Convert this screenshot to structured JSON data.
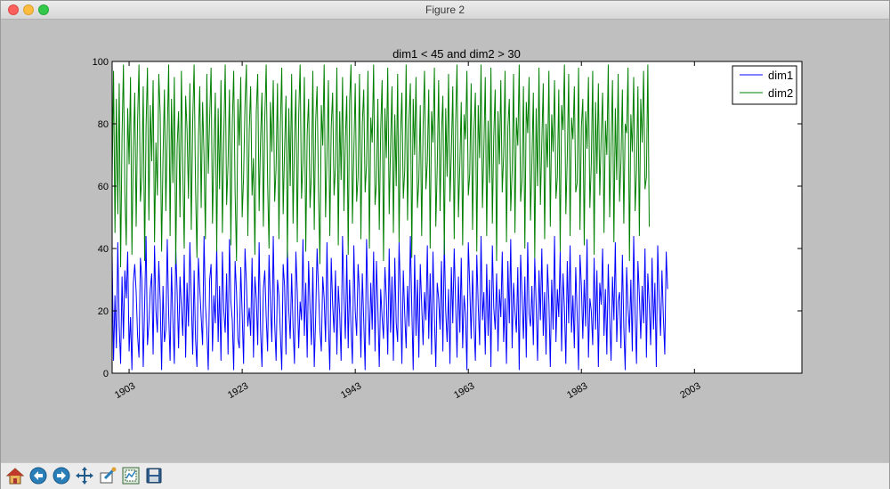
{
  "window": {
    "title": "Figure 2"
  },
  "toolbar": {
    "buttons": [
      {
        "name": "home-button",
        "icon": "home-icon"
      },
      {
        "name": "back-button",
        "icon": "back-arrow-icon"
      },
      {
        "name": "forward-button",
        "icon": "forward-arrow-icon"
      },
      {
        "name": "pan-button",
        "icon": "pan-arrows-icon"
      },
      {
        "name": "zoom-button",
        "icon": "zoom-rect-icon"
      },
      {
        "name": "subplots-button",
        "icon": "subplots-config-icon"
      },
      {
        "name": "save-button",
        "icon": "floppy-disk-icon"
      }
    ]
  },
  "chart_data": {
    "type": "line",
    "title": "dim1 < 45 and dim2 > 30",
    "xlabel": "",
    "ylabel": "",
    "xlim": [
      1900,
      2022
    ],
    "ylim": [
      0,
      100
    ],
    "xticks": [
      "1903",
      "1923",
      "1943",
      "1963",
      "1983",
      "2003"
    ],
    "yticks": [
      0,
      20,
      40,
      60,
      80,
      100
    ],
    "legend": {
      "loc": "upper right",
      "entries": [
        "dim1",
        "dim2"
      ]
    },
    "grid": false,
    "colors": {
      "dim1": "#0000ff",
      "dim2": "#007f00"
    },
    "series": [
      {
        "name": "dim1",
        "x_start": 1900,
        "x_step": 0.25,
        "values": [
          38,
          4,
          25,
          8,
          42,
          15,
          3,
          31,
          11,
          33,
          24,
          39,
          7,
          18,
          1,
          29,
          35,
          26,
          12,
          5,
          37,
          30,
          2,
          22,
          44,
          9,
          16,
          27,
          32,
          6,
          41,
          20,
          13,
          36,
          23,
          1,
          28,
          10,
          14,
          43,
          19,
          4,
          34,
          17,
          3,
          40,
          26,
          8,
          31,
          21,
          12,
          38,
          5,
          29,
          15,
          42,
          24,
          6,
          33,
          11,
          2,
          37,
          27,
          18,
          9,
          44,
          22,
          14,
          1,
          30,
          35,
          7,
          25,
          16,
          41,
          10,
          28,
          4,
          39,
          20,
          13,
          32,
          6,
          43,
          23,
          17,
          1,
          36,
          26,
          11,
          8,
          34,
          19,
          3,
          40,
          29,
          15,
          21,
          12,
          37,
          5,
          31,
          24,
          9,
          42,
          14,
          2,
          27,
          33,
          18,
          7,
          38,
          22,
          10,
          44,
          16,
          4,
          30,
          25,
          13,
          1,
          35,
          28,
          6,
          41,
          20,
          11,
          32,
          15,
          3,
          39,
          26,
          8,
          23,
          17,
          43,
          12,
          29,
          5,
          36,
          21,
          9,
          34,
          2,
          18,
          40,
          27,
          14,
          7,
          31,
          24,
          10,
          42,
          16,
          1,
          37,
          22,
          13,
          33,
          6,
          28,
          19,
          4,
          44,
          25,
          11,
          38,
          8,
          30,
          15,
          3,
          41,
          20,
          12,
          35,
          26,
          5,
          32,
          17,
          1,
          43,
          23,
          9,
          29,
          14,
          39,
          7,
          36,
          21,
          2,
          27,
          18,
          11,
          34,
          24,
          6,
          40,
          13,
          31,
          4,
          37,
          16,
          10,
          42,
          25,
          3,
          33,
          19,
          8,
          28,
          15,
          44,
          21,
          1,
          38,
          12,
          30,
          5,
          35,
          22,
          9,
          26,
          17,
          41,
          11,
          32,
          6,
          39,
          18,
          2,
          29,
          24,
          14,
          36,
          7,
          43,
          20,
          10,
          27,
          3,
          34,
          16,
          40,
          23,
          5,
          31,
          13,
          37,
          8,
          25,
          19,
          1,
          42,
          28,
          11,
          33,
          15,
          4,
          38,
          22,
          9,
          44,
          17,
          26,
          6,
          35,
          12,
          30,
          2,
          41,
          21,
          14,
          32,
          7,
          27,
          18,
          39,
          10,
          24,
          3,
          36,
          16,
          43,
          8,
          29,
          20,
          13,
          34,
          1,
          38,
          25,
          11,
          31,
          5,
          42,
          19,
          15,
          28,
          9,
          37,
          22,
          4,
          33,
          17,
          40,
          12,
          26,
          6,
          35,
          23,
          2,
          30,
          14,
          44,
          10,
          27,
          18,
          39,
          7,
          32,
          21,
          3,
          36,
          16,
          41,
          13,
          25,
          8,
          34,
          19,
          1,
          38,
          28,
          11,
          30,
          15,
          43,
          5,
          24,
          20,
          9,
          37,
          14,
          33,
          2,
          29,
          22,
          40,
          12,
          27,
          6,
          35,
          18,
          4,
          31,
          17,
          42,
          10,
          23,
          26,
          8,
          38,
          15,
          1,
          34,
          21,
          13,
          30,
          7,
          44,
          19,
          3,
          36,
          25,
          11,
          28,
          16,
          40,
          5,
          32,
          22,
          9,
          37,
          14,
          29,
          2,
          41,
          24,
          12,
          33,
          18,
          6,
          39,
          27
        ]
      },
      {
        "name": "dim2",
        "x_start": 1900,
        "x_step": 0.25,
        "values": [
          62,
          97,
          45,
          88,
          51,
          93,
          34,
          76,
          99,
          58,
          41,
          85,
          67,
          95,
          38,
          72,
          90,
          47,
          81,
          99,
          55,
          63,
          92,
          36,
          79,
          98,
          49,
          86,
          68,
          94,
          42,
          74,
          57,
          96,
          83,
          39,
          69,
          91,
          52,
          77,
          99,
          44,
          88,
          61,
          95,
          35,
          73,
          84,
          50,
          97,
          65,
          40,
          89,
          78,
          56,
          93,
          46,
          81,
          99,
          60,
          37,
          75,
          92,
          53,
          87,
          70,
          43,
          96,
          64,
          82,
          98,
          48,
          71,
          90,
          39,
          85,
          59,
          94,
          45,
          76,
          99,
          54,
          67,
          91,
          41,
          80,
          97,
          58,
          36,
          88,
          73,
          95,
          50,
          63,
          86,
          99,
          44,
          78,
          92,
          57,
          69,
          38,
          84,
          96,
          52,
          75,
          90,
          47,
          82,
          99,
          61,
          40,
          87,
          71,
          94,
          55,
          66,
          93,
          43,
          79,
          98,
          51,
          72,
          89,
          37,
          85,
          60,
          96,
          48,
          74,
          91,
          42,
          83,
          99,
          56,
          68,
          95,
          39,
          77,
          88,
          53,
          64,
          97,
          46,
          81,
          92,
          59,
          35,
          86,
          73,
          99,
          50,
          70,
          94,
          44,
          79,
          90,
          57,
          66,
          98,
          41,
          84,
          62,
          95,
          52,
          75,
          89,
          38,
          87,
          99,
          48,
          71,
          93,
          55,
          63,
          96,
          43,
          80,
          91,
          58,
          67,
          97,
          40,
          82,
          74,
          99,
          54,
          61,
          88,
          46,
          78,
          94,
          36,
          85,
          69,
          98,
          51,
          73,
          92,
          45,
          83,
          60,
          96,
          42,
          76,
          90,
          56,
          65,
          99,
          49,
          81,
          93,
          37,
          88,
          70,
          95,
          53,
          62,
          86,
          44,
          79,
          97,
          59,
          68,
          91,
          40,
          84,
          74,
          98,
          47,
          66,
          94,
          52,
          77,
          89,
          38,
          85,
          63,
          96,
          55,
          71,
          92,
          43,
          80,
          99,
          50,
          67,
          87,
          41,
          83,
          75,
          97,
          57,
          64,
          93,
          46,
          78,
          90,
          39,
          86,
          69,
          99,
          53,
          72,
          95,
          44,
          81,
          61,
          98,
          48,
          76,
          91,
          36,
          84,
          67,
          94,
          58,
          70,
          97,
          42,
          79,
          88,
          52,
          65,
          96,
          45,
          82,
          73,
          99,
          55,
          62,
          92,
          40,
          87,
          77,
          95,
          49,
          68,
          90,
          37,
          85,
          60,
          98,
          54,
          74,
          93,
          43,
          80,
          66,
          97,
          47,
          83,
          71,
          94,
          56,
          63,
          91,
          39,
          86,
          78,
          99,
          51,
          69,
          96,
          44,
          82,
          75,
          92,
          58,
          61,
          98,
          46,
          79,
          88,
          41,
          84,
          72,
          95,
          53,
          67,
          97,
          38,
          87,
          64,
          93,
          57,
          76,
          90,
          45,
          81,
          70,
          99,
          50,
          73,
          94,
          42,
          85,
          62,
          96,
          55,
          68,
          91,
          48,
          80,
          77,
          98,
          36,
          83,
          71,
          95,
          52,
          65,
          92,
          44,
          88,
          74,
          97,
          59,
          63,
          99,
          47
        ]
      }
    ]
  }
}
